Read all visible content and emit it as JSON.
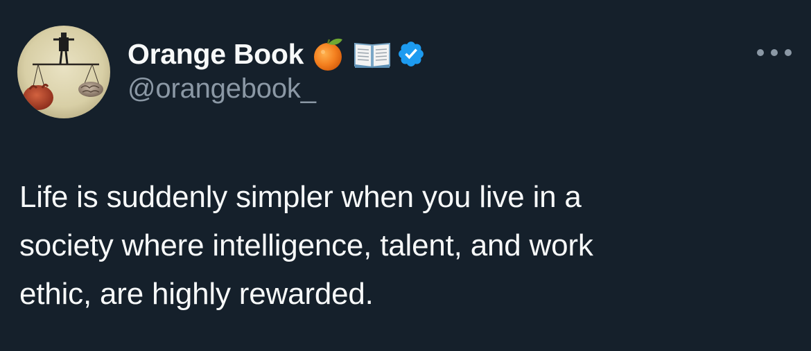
{
  "author": {
    "display_name": "Orange Book",
    "handle": "@orangebook_",
    "name_emojis": [
      "orange-emoji",
      "open-book-emoji"
    ],
    "verified": true,
    "verified_color": "#1d9bf0"
  },
  "tweet": {
    "text": "Life is suddenly simpler when you live in a\nsociety where intelligence, talent, and work\nethic, are highly rewarded."
  },
  "menu": {
    "icon": "more-horizontal-icon"
  },
  "colors": {
    "background": "#15202b",
    "primary_text": "#f7f9f9",
    "secondary_text": "#8b98a5"
  }
}
